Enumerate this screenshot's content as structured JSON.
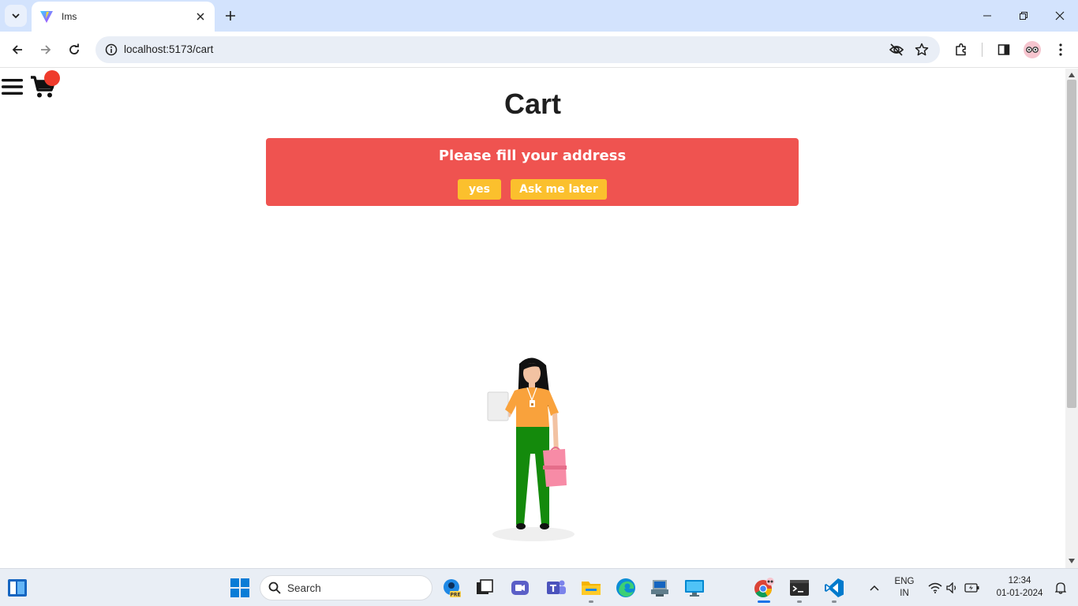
{
  "browser": {
    "tab_title": "Ims",
    "url": "localhost:5173/cart"
  },
  "page": {
    "title": "Cart",
    "alert": {
      "message": "Please fill your address",
      "yes_label": "yes",
      "later_label": "Ask me later",
      "background": "#ef5350",
      "button_color": "#fbc02d"
    },
    "cart_badge_color": "#ef3b2c"
  },
  "taskbar": {
    "search_label": "Search",
    "language": "ENG",
    "region": "IN",
    "time": "12:34",
    "date": "01-01-2024"
  }
}
